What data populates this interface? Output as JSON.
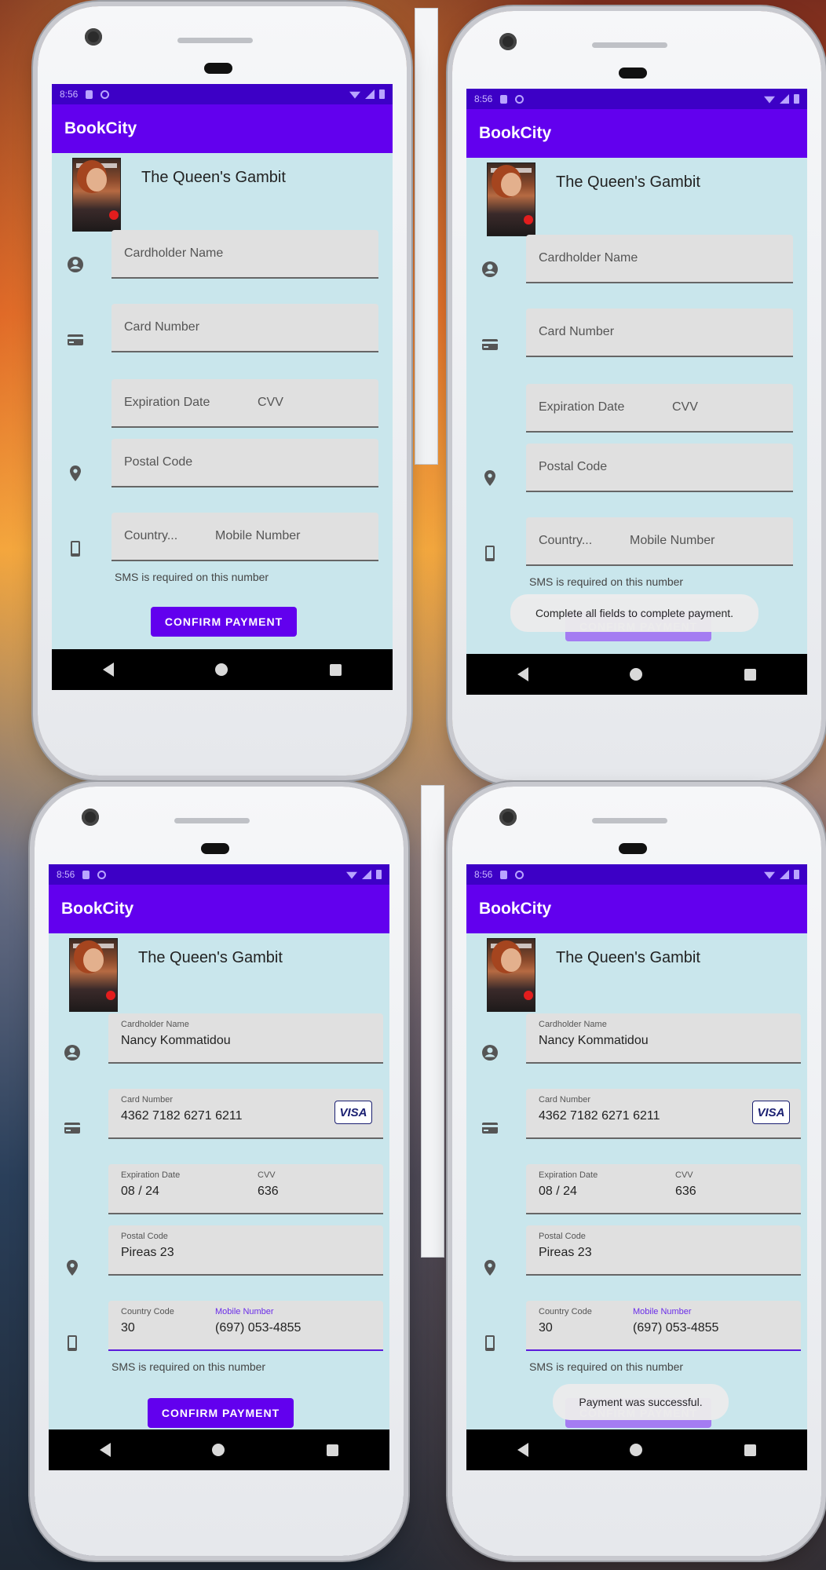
{
  "colors": {
    "primary": "#6200ee",
    "status_bar": "#3d00c6",
    "screen_bg": "#c9e6ec",
    "field_bg": "#e0e0e0",
    "active_underline": "#5b1bdc"
  },
  "status_time": "8:56",
  "app_title": "BookCity",
  "book": {
    "title": "The Queen's Gambit",
    "cover_icon": "book-cover-image"
  },
  "placeholders": {
    "cardholder": "Cardholder Name",
    "card_number": "Card Number",
    "expiration": "Expiration Date",
    "cvv": "CVV",
    "postal": "Postal Code",
    "country": "Country...",
    "mobile": "Mobile Number"
  },
  "labels": {
    "cardholder": "Cardholder Name",
    "card_number": "Card Number",
    "expiration": "Expiration Date",
    "cvv": "CVV",
    "postal": "Postal Code",
    "country": "Country Code",
    "mobile": "Mobile Number"
  },
  "values": {
    "cardholder": "Nancy Kommatidou",
    "card_number": "4362 7182 6271 6211",
    "expiration": "08 / 24",
    "cvv": "636",
    "postal": "Pireas 23",
    "country": "30",
    "mobile": "(697) 053-4855"
  },
  "card_brand": "VISA",
  "helper_text": "SMS is required on this number",
  "confirm_label": "CONFIRM PAYMENT",
  "toasts": {
    "incomplete": "Complete all fields to complete payment.",
    "success": "Payment was successful."
  },
  "icons": [
    "account-circle-icon",
    "credit-card-icon",
    "location-pin-icon",
    "smartphone-icon",
    "back-nav-icon",
    "home-nav-icon",
    "recents-nav-icon"
  ]
}
